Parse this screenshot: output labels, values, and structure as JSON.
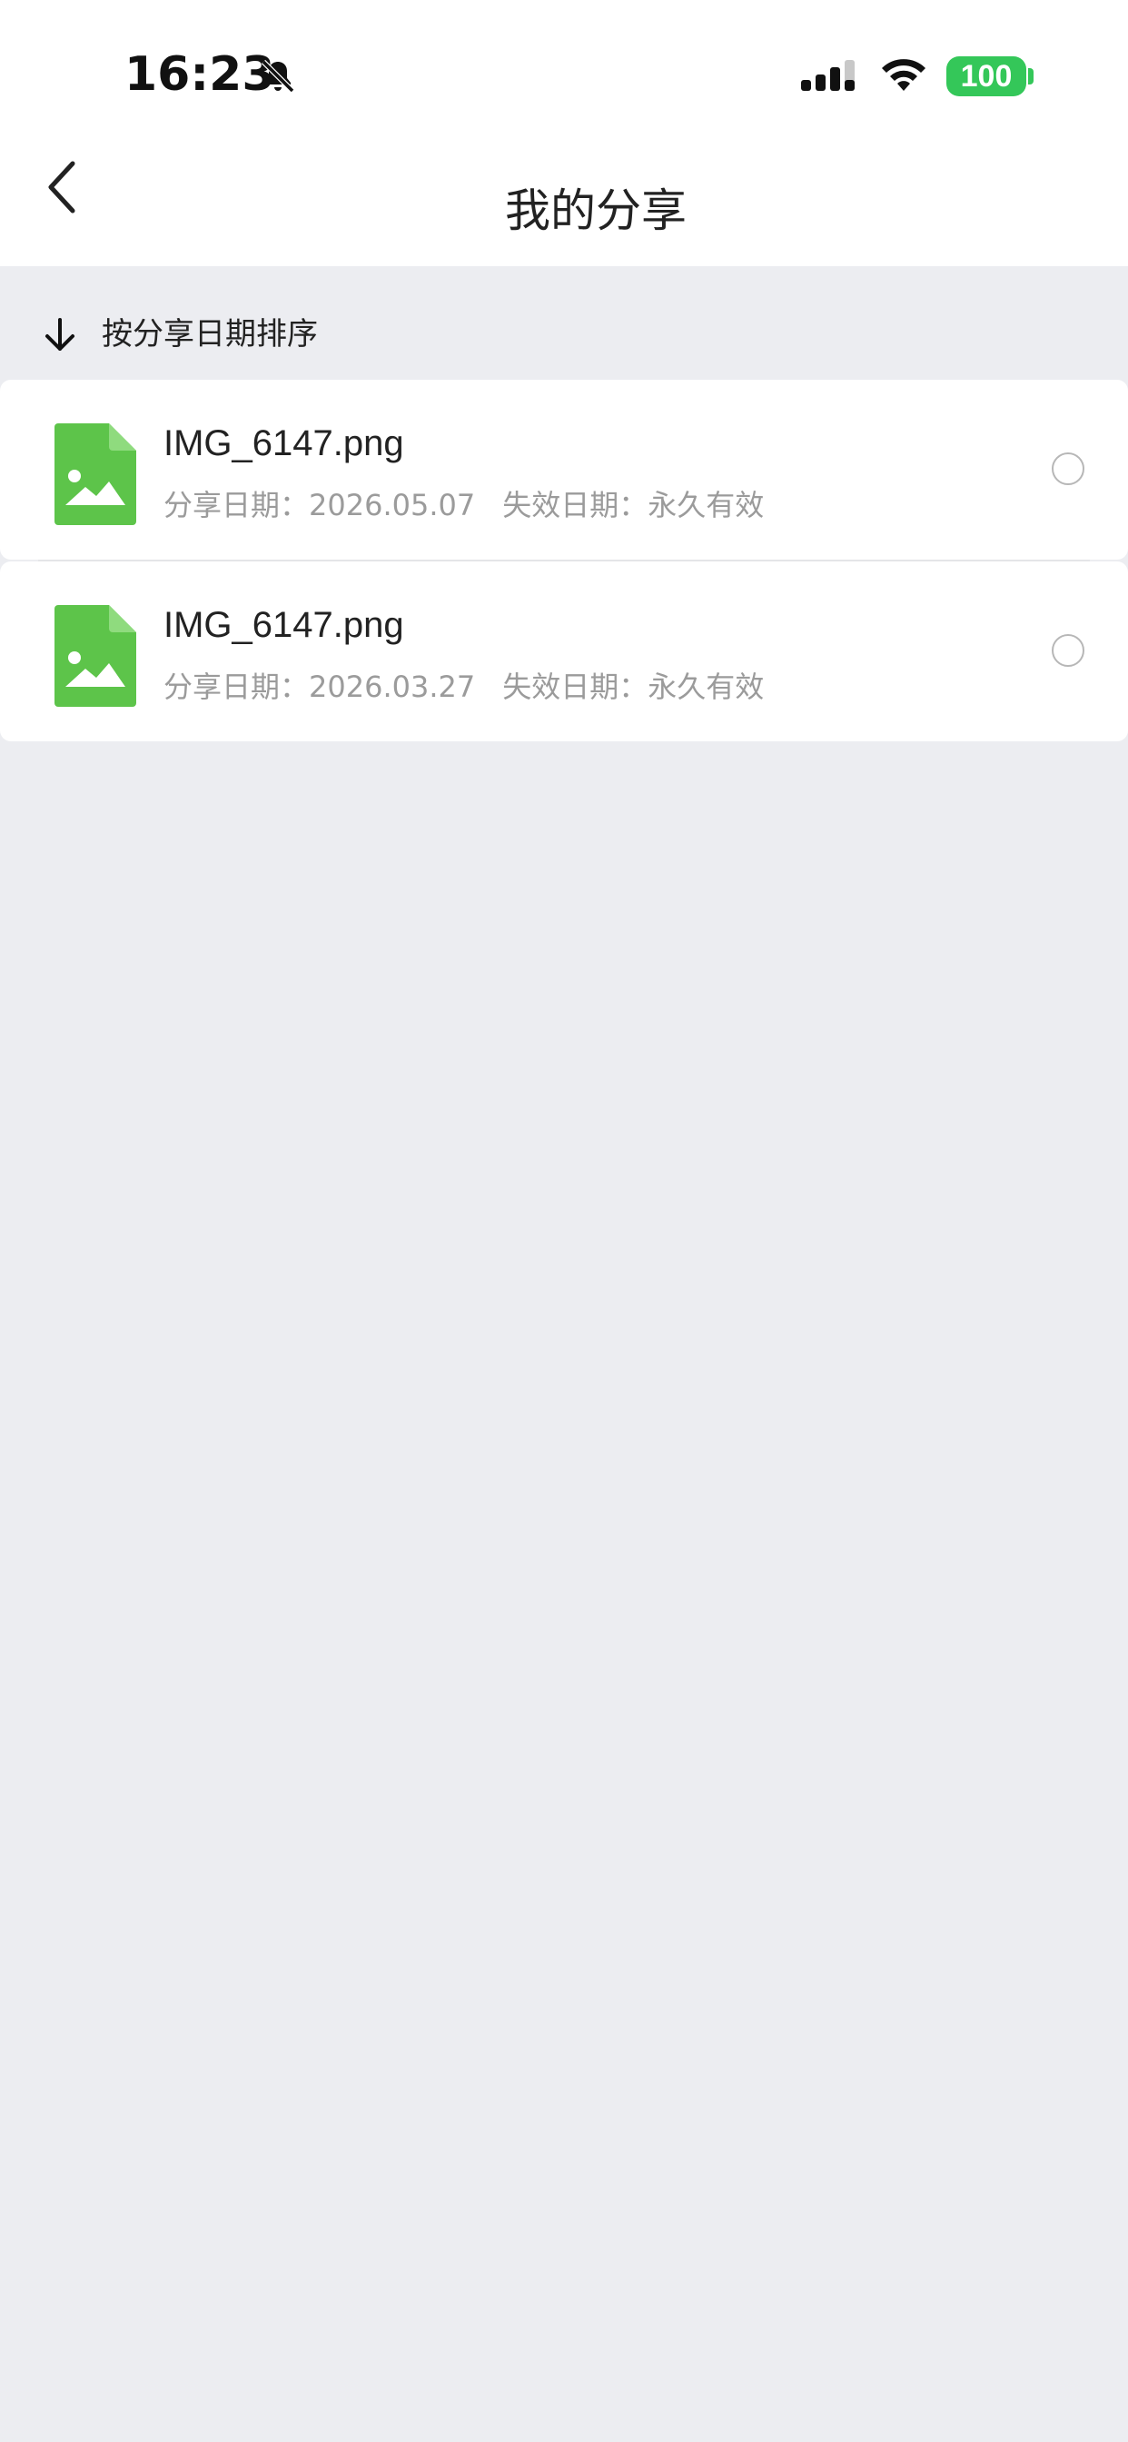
{
  "status_bar": {
    "time": "16:23",
    "battery": "100",
    "icons": [
      "bell-slash-icon",
      "signal-icon",
      "wifi-icon",
      "battery-icon"
    ]
  },
  "header": {
    "title": "我的分享",
    "back_icon": "chevron-left-icon"
  },
  "sort": {
    "icon": "arrow-down-icon",
    "label": "按分享日期排序"
  },
  "files": [
    {
      "name": "IMG_6147.png",
      "icon": "image-file-icon",
      "share_label": "分享日期：",
      "share_date": "2026.05.07",
      "expire_label": "失效日期：",
      "expire_value": "永久有效"
    },
    {
      "name": "IMG_6147.png",
      "icon": "image-file-icon",
      "share_label": "分享日期：",
      "share_date": "2026.03.27",
      "expire_label": "失效日期：",
      "expire_value": "永久有效"
    }
  ],
  "colors": {
    "file_icon_green": "#5dc44a",
    "battery_green": "#34c759",
    "page_background": "#ecedf1"
  }
}
